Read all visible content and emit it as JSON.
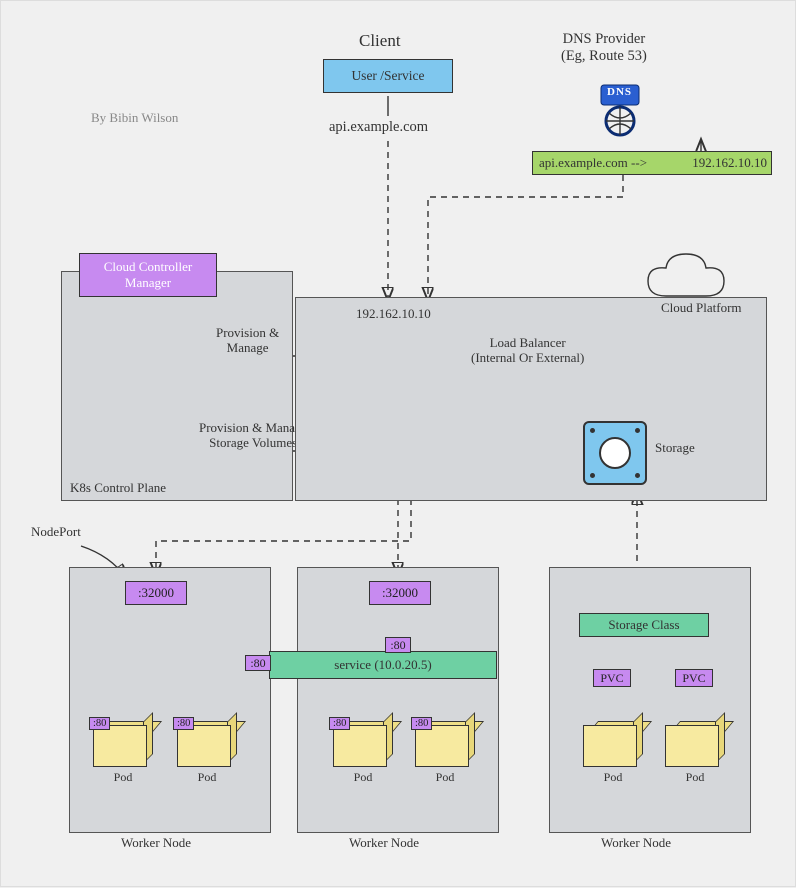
{
  "credits": "By Bibin Wilson",
  "client": {
    "title": "Client",
    "box_label": "User /Service",
    "domain": "api.example.com"
  },
  "dns": {
    "title": "DNS Provider\n(Eg, Route 53)",
    "badge": "DNS",
    "record": "api.example.com -->",
    "ip": "192.162.10.10"
  },
  "controlPlane": {
    "ccm": "Cloud Controller\nManager",
    "panel_label": "K8s Control Plane",
    "arrow1": "Provision &\nManage",
    "arrow2": "Provision & Manage\nStorage Volumes"
  },
  "cloud": {
    "ip": "192.162.10.10",
    "lb": "Load Balancer\n(Internal Or External)",
    "storage_label": "Storage",
    "platform": "Cloud Platform"
  },
  "workers": {
    "nodeport_label": "NodePort",
    "nodeports": [
      ":32000",
      ":32000"
    ],
    "service_port": ":80",
    "service_label": "service (10.0.20.5)",
    "pod_port": ":80",
    "pod_label": "Pod",
    "pvc_label": "PVC",
    "storage_class": "Storage Class",
    "node_label": "Worker Node"
  }
}
